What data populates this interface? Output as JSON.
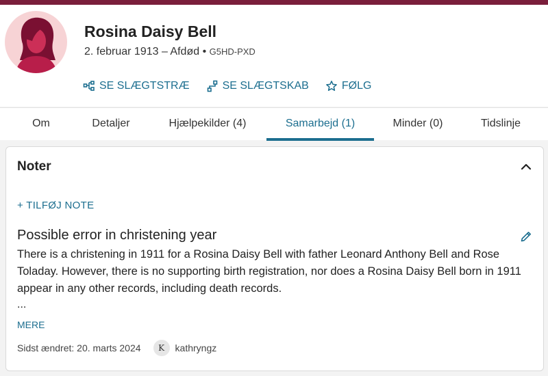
{
  "person": {
    "name": "Rosina Daisy Bell",
    "dates": "2. februar 1913 – Afdød",
    "separator": "•",
    "pid": "G5HD-PXD"
  },
  "actions": [
    {
      "label": "SE SLÆGTSTRÆ",
      "icon": "tree-icon"
    },
    {
      "label": "SE SLÆGTSKAB",
      "icon": "relationship-icon"
    },
    {
      "label": "FØLG",
      "icon": "star-icon"
    }
  ],
  "tabs": [
    {
      "label": "Om"
    },
    {
      "label": "Detaljer"
    },
    {
      "label": "Hjælpekilder (4)"
    },
    {
      "label": "Samarbejd (1)",
      "active": true
    },
    {
      "label": "Minder (0)"
    },
    {
      "label": "Tidslinje"
    }
  ],
  "notes": {
    "title": "Noter",
    "add_label": "+ TILFØJ NOTE",
    "item": {
      "title": "Possible error in christening year",
      "body": "There is a christening in 1911 for a Rosina Daisy Bell with father Leonard Anthony Bell and Rose Toladay. However, there is no supporting birth registration, nor does a Rosina Daisy Bell born in 1911 appear in any other records, including death records.",
      "ellipsis": "...",
      "more_label": "MERE",
      "modified": "Sidst ændret: 20. marts 2024",
      "author_initial": "K",
      "author": "kathryngz"
    }
  },
  "colors": {
    "brand": "#7a1e3b",
    "accent": "#1c6e8f",
    "avatar_bg": "#f7d3d5",
    "avatar_fg": "#a3183f"
  }
}
